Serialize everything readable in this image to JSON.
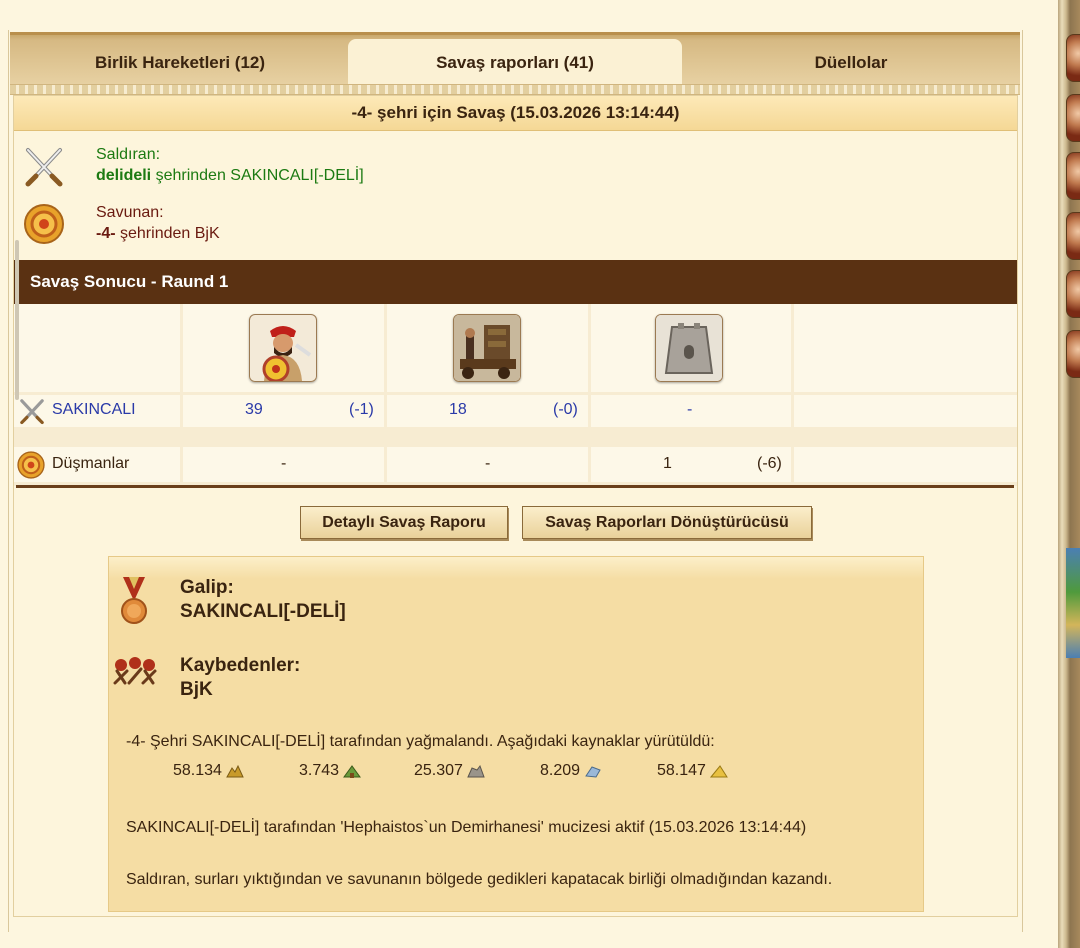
{
  "tabs": [
    {
      "label": "Birlik Hareketleri (12)"
    },
    {
      "label": "Savaş raporları (41)"
    },
    {
      "label": "Düellolar"
    }
  ],
  "report": {
    "title": "-4- şehri için Savaş (15.03.2026 13:14:44)",
    "attacker": {
      "label": "Saldıran:",
      "city": "delideli",
      "rest": " şehrinden SAKINCALI[-DELİ]"
    },
    "defender": {
      "label": "Savunan:",
      "city": "-4-",
      "rest": " şehrinden BjK"
    },
    "round_title": "Savaş Sonucu - Raund 1",
    "units": [
      "swordsman-unit-icon",
      "siege-tower-unit-icon",
      "wall-unit-icon"
    ],
    "rows": [
      {
        "name": "SAKINCALI",
        "icon": "crossed-swords-icon",
        "cells": [
          {
            "count": "39",
            "loss": "(-1)"
          },
          {
            "count": "18",
            "loss": "(-0)"
          },
          {
            "count": "-",
            "loss": ""
          }
        ]
      },
      {
        "name": "Düşmanlar",
        "icon": "shield-icon",
        "cells": [
          {
            "count": "-",
            "loss": ""
          },
          {
            "count": "-",
            "loss": ""
          },
          {
            "count": "1",
            "loss": "(-6)"
          }
        ]
      }
    ],
    "buttons": {
      "detailed": "Detaylı Savaş Raporu",
      "converter": "Savaş Raporları Dönüştürücüsü"
    },
    "summary": {
      "winner_label": "Galip:",
      "winner": "SAKINCALI[-DELİ]",
      "losers_label": "Kaybedenler:",
      "losers": "BjK",
      "loot_text": "-4- Şehri SAKINCALI[-DELİ] tarafından yağmalandı. Aşağıdaki kaynaklar yürütüldü:",
      "resources": [
        {
          "value": "58.134",
          "icon": "gold-icon"
        },
        {
          "value": "3.743",
          "icon": "wood-icon"
        },
        {
          "value": "25.307",
          "icon": "stone-icon"
        },
        {
          "value": "8.209",
          "icon": "iron-icon"
        },
        {
          "value": "58.147",
          "icon": "food-icon"
        }
      ],
      "wonder_text": "SAKINCALI[-DELİ] tarafından 'Hephaistos`un Demirhanesi' mucizesi aktif (15.03.2026 13:14:44)",
      "reason_text": "Saldıran, surları yıktığından ve savunanın bölgede gedikleri kapatacak birliği olmadığından kazandı."
    }
  },
  "colors": {
    "attacker": "#1c7a12",
    "defender": "#6a1a10",
    "bar": "#5a3112",
    "blue": "#2a3aa8"
  }
}
